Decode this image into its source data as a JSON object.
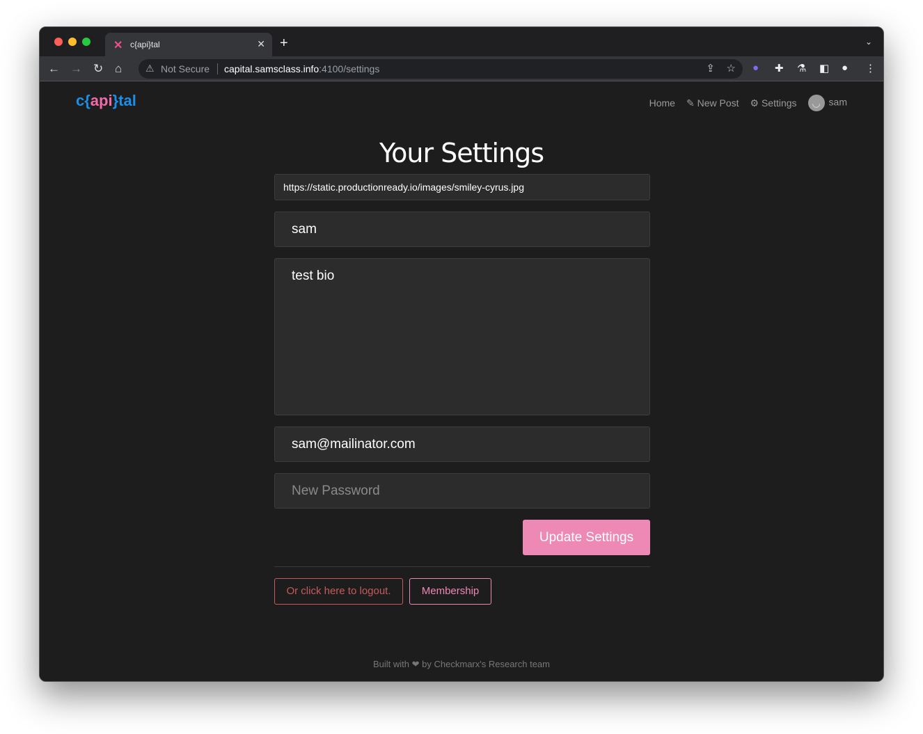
{
  "browser": {
    "tab_title": "c{api}tal",
    "not_secure": "Not Secure",
    "url_host": "capital.samsclass.info",
    "url_path": ":4100/settings"
  },
  "header": {
    "logo": {
      "a": "c{",
      "b": "api",
      "c": "}tal"
    },
    "nav": {
      "home": "Home",
      "new_post": "New Post",
      "settings": "Settings",
      "user": "sam"
    }
  },
  "page": {
    "title": "Your Settings",
    "image_url": "https://static.productionready.io/images/smiley-cyrus.jpg",
    "username": "sam",
    "bio": "test bio",
    "email": "sam@mailinator.com",
    "password_placeholder": "New Password",
    "update_button": "Update Settings",
    "logout_button": "Or click here to logout.",
    "membership_button": "Membership"
  },
  "footer": {
    "a": "Built with",
    "b": "by Checkmarx's Research team"
  },
  "colors": {
    "accent": "#ee88b5",
    "logo_blue": "#1b8fe8",
    "danger": "#c65b5b"
  }
}
